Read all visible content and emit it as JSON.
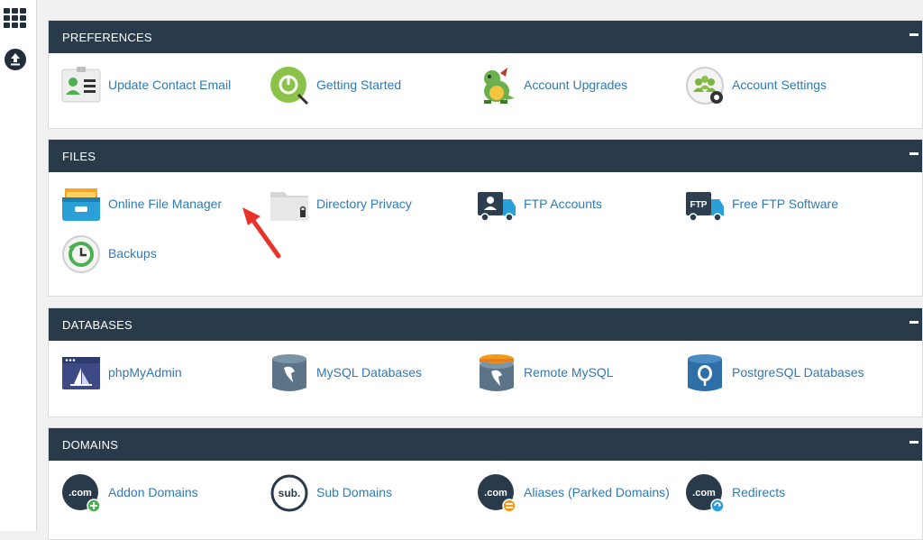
{
  "sections": {
    "preferences": {
      "title": "PREFERENCES",
      "items": [
        "Update Contact Email",
        "Getting Started",
        "Account Upgrades",
        "Account Settings"
      ]
    },
    "files": {
      "title": "FILES",
      "items": [
        "Online File Manager",
        "Directory Privacy",
        "FTP Accounts",
        "Free FTP Software",
        "Backups"
      ]
    },
    "databases": {
      "title": "DATABASES",
      "items": [
        "phpMyAdmin",
        "MySQL Databases",
        "Remote MySQL",
        "PostgreSQL Databases"
      ]
    },
    "domains": {
      "title": "DOMAINS",
      "items": [
        "Addon Domains",
        "Sub Domains",
        "Aliases (Parked Domains)",
        "Redirects"
      ]
    }
  },
  "icon_text": {
    "ftp": "FTP",
    "com": ".com",
    "sub": "sub."
  },
  "colors": {
    "header_bg": "#293a4a",
    "link": "#2f7ab8",
    "annotation_arrow": "#e8332a"
  }
}
